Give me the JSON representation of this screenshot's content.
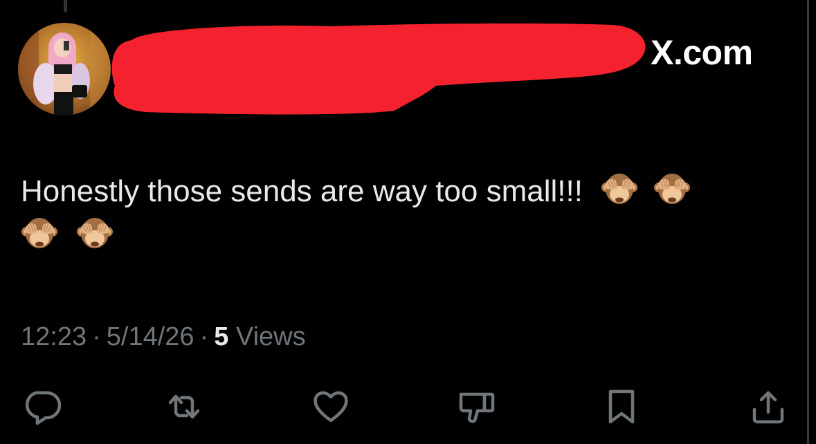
{
  "header": {
    "brand_label": "X.com",
    "redaction_color": "#f4222f"
  },
  "tweet": {
    "text": "Honestly those sends are way too small!!!",
    "emoji": "see-no-evil-monkey",
    "emoji_count": 4,
    "time": "12:23",
    "date": "5/14/26",
    "separator": "·",
    "views_count": "5",
    "views_label": "Views"
  },
  "actions": [
    {
      "name": "reply-icon"
    },
    {
      "name": "retweet-icon"
    },
    {
      "name": "like-icon"
    },
    {
      "name": "dislike-icon"
    },
    {
      "name": "bookmark-icon"
    },
    {
      "name": "share-icon"
    }
  ],
  "colors": {
    "background": "#000000",
    "text_primary": "#e7e9ea",
    "text_secondary": "#71767b",
    "icon": "#71767b"
  }
}
